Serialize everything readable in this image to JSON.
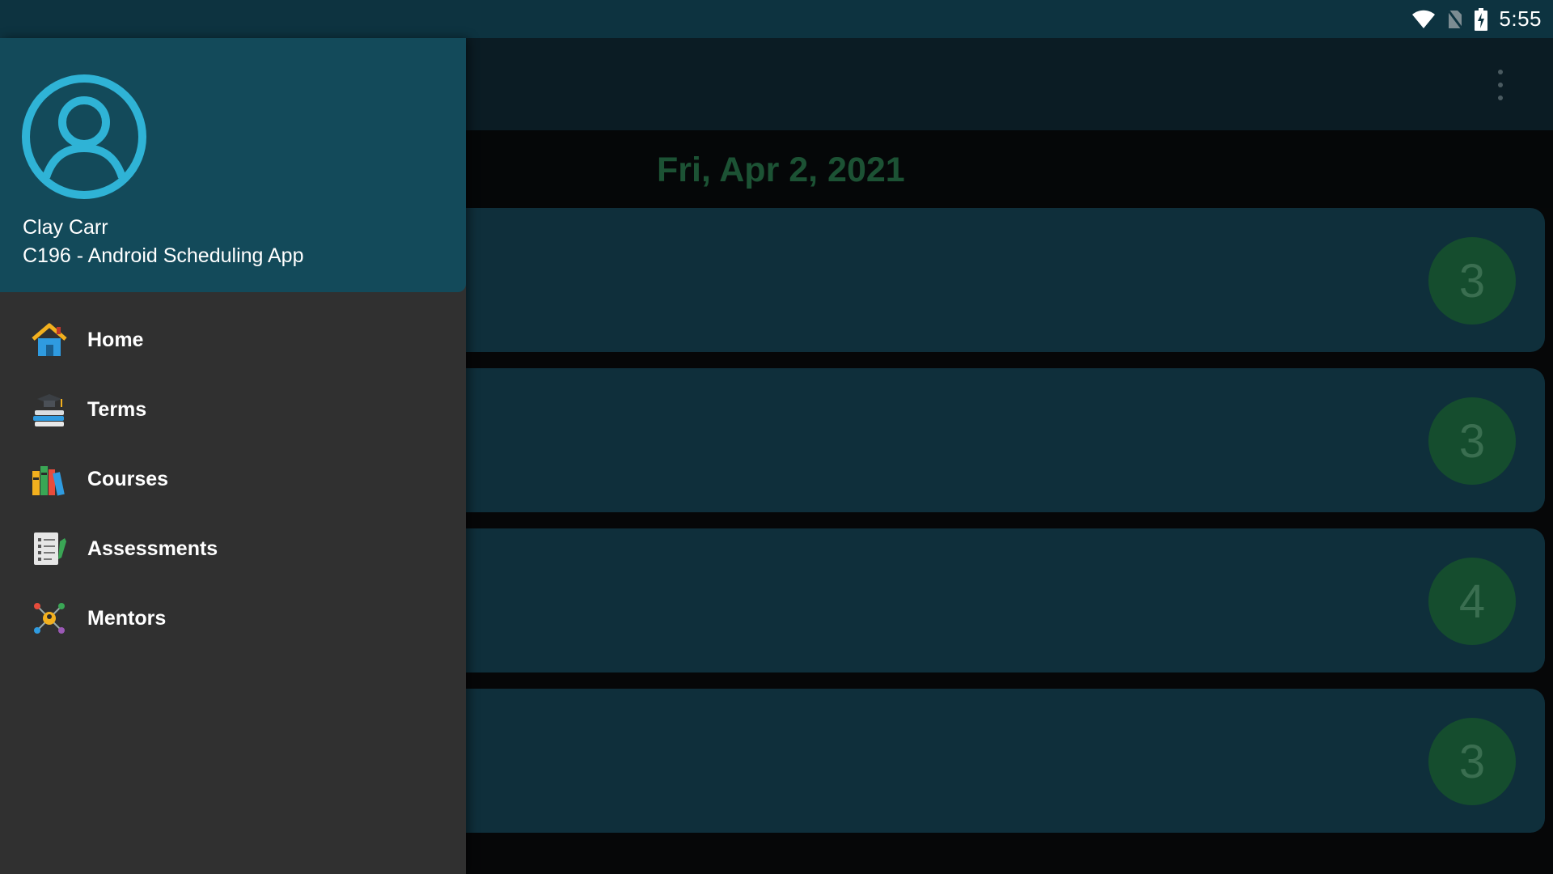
{
  "status_bar": {
    "time": "5:55",
    "icons": [
      "wifi-icon",
      "no-sim-icon",
      "battery-charging-icon"
    ]
  },
  "toolbar": {
    "overflow_icon": "more-vert-icon"
  },
  "main": {
    "date": "Fri, Apr 2, 2021",
    "cards": [
      {
        "count": "3"
      },
      {
        "count": "3"
      },
      {
        "count": "4"
      },
      {
        "count": "3"
      }
    ]
  },
  "drawer": {
    "header": {
      "user_name": "Clay Carr",
      "subtitle": "C196 - Android Scheduling App",
      "avatar_icon": "account-circle-icon"
    },
    "items": [
      {
        "label": "Home",
        "icon": "home-icon"
      },
      {
        "label": "Terms",
        "icon": "graduation-books-icon"
      },
      {
        "label": "Courses",
        "icon": "books-icon"
      },
      {
        "label": "Assessments",
        "icon": "document-checklist-icon"
      },
      {
        "label": "Mentors",
        "icon": "network-people-icon"
      }
    ]
  },
  "colors": {
    "status_bar_bg": "#0d3340",
    "drawer_header_bg": "#134a5a",
    "drawer_bg": "#303030",
    "avatar_accent": "#2fb3d6",
    "card_bg": "#0f2f3b",
    "count_circle_bg": "#154d2e",
    "date_text": "#1c5234"
  }
}
